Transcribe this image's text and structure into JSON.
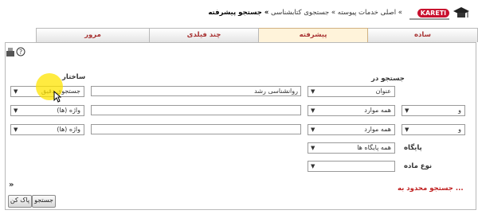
{
  "header": {
    "brand": "KARETl",
    "crumb_1": "» اصلی خدمات پیوسته",
    "crumb_2": "» جستجوی کتابشناسی",
    "crumb_current": "» جستجو پیشرفته"
  },
  "tabs": [
    "ساده",
    "پیشرفته",
    "چند فیلدی",
    "مرور"
  ],
  "active_tab": "پیشرفته",
  "form": {
    "search_in_label": "جستجو در",
    "structure_label": "ساختار",
    "rows": [
      {
        "bool": "",
        "field": "عنوان",
        "term": "روانشناسی رشد",
        "structure": "جستجوی دقیق"
      },
      {
        "bool": "و",
        "field": "همه موارد",
        "term": "",
        "structure": "واژه (ها)"
      },
      {
        "bool": "و",
        "field": "همه موارد",
        "term": "",
        "structure": "واژه (ها)"
      }
    ],
    "database_label": "پایگاه",
    "database_value": "همه پایگاه ها",
    "material_label": "نوع ماده",
    "material_value": "",
    "limited_label": "جستجو محدود به ...",
    "search_button": "جستجو",
    "clear_button": "پاک کن"
  },
  "icons": [
    "help-icon",
    "settings-icon",
    "expand-icon",
    "cursor-icon",
    "graduation-cap-icon"
  ]
}
